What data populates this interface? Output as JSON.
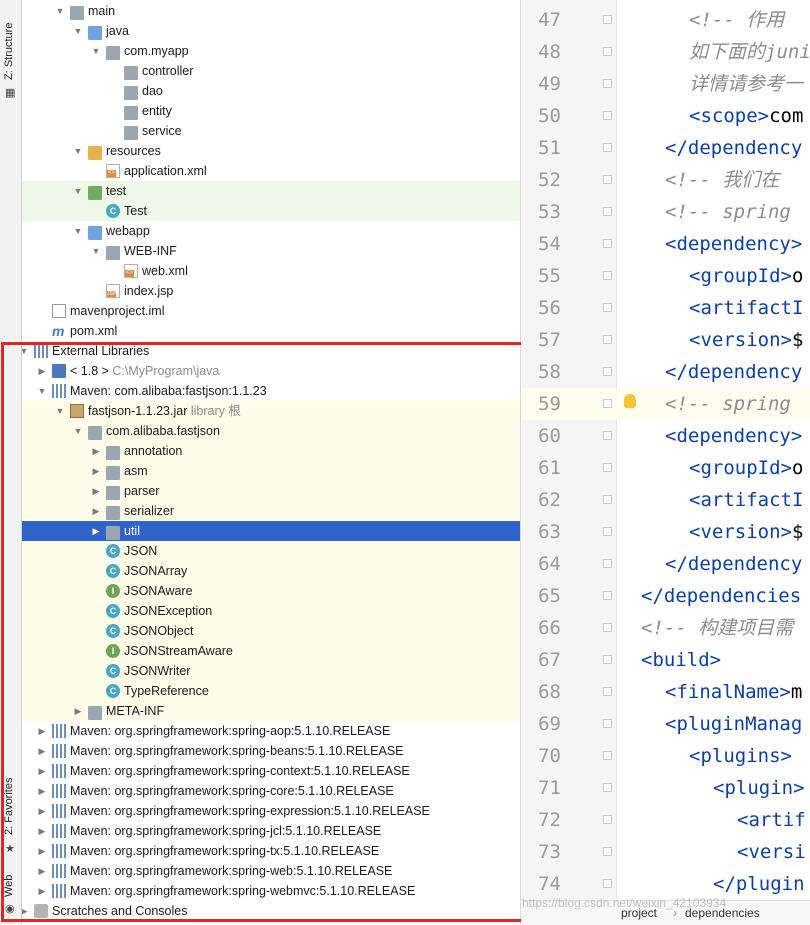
{
  "strip": {
    "structure": "Z: Structure",
    "favorites": "2: Favorites",
    "web": "Web"
  },
  "tree": [
    {
      "label": "main",
      "icon": "folder",
      "color": "gray",
      "depth": 3,
      "arrow": "down"
    },
    {
      "label": "java",
      "icon": "folder",
      "color": "blue",
      "depth": 4,
      "arrow": "down"
    },
    {
      "label": "com.myapp",
      "icon": "folder",
      "color": "gray",
      "depth": 5,
      "arrow": "down"
    },
    {
      "label": "controller",
      "icon": "folder",
      "color": "gray",
      "depth": 6,
      "arrow": ""
    },
    {
      "label": "dao",
      "icon": "folder",
      "color": "gray",
      "depth": 6,
      "arrow": ""
    },
    {
      "label": "entity",
      "icon": "folder",
      "color": "gray",
      "depth": 6,
      "arrow": ""
    },
    {
      "label": "service",
      "icon": "folder",
      "color": "gray",
      "depth": 6,
      "arrow": ""
    },
    {
      "label": "resources",
      "icon": "folder",
      "color": "yellow",
      "depth": 4,
      "arrow": "down"
    },
    {
      "label": "application.xml",
      "icon": "xml",
      "depth": 5,
      "arrow": ""
    },
    {
      "label": "test",
      "icon": "folder",
      "color": "green",
      "depth": 4,
      "arrow": "down",
      "hl": "green"
    },
    {
      "label": "Test",
      "icon": "class",
      "depth": 5,
      "arrow": "",
      "hl": "green"
    },
    {
      "label": "webapp",
      "icon": "folder",
      "color": "blue",
      "depth": 4,
      "arrow": "down"
    },
    {
      "label": "WEB-INF",
      "icon": "folder",
      "color": "gray",
      "depth": 5,
      "arrow": "down"
    },
    {
      "label": "web.xml",
      "icon": "xml",
      "depth": 6,
      "arrow": ""
    },
    {
      "label": "index.jsp",
      "icon": "jsp",
      "depth": 5,
      "arrow": ""
    },
    {
      "label": "mavenproject.iml",
      "icon": "iml",
      "depth": 2,
      "arrow": ""
    },
    {
      "label": "pom.xml",
      "icon": "mvn",
      "depth": 2,
      "arrow": ""
    },
    {
      "label": "External Libraries",
      "icon": "lib",
      "depth": 1,
      "arrow": "down"
    },
    {
      "label": "< 1.8 >",
      "extra": "C:\\MyProgram\\java",
      "icon": "sdk",
      "depth": 2,
      "arrow": "right"
    },
    {
      "label": "Maven: com.alibaba:fastjson:1.1.23",
      "icon": "lib",
      "depth": 2,
      "arrow": "down"
    },
    {
      "label": "fastjson-1.1.23.jar",
      "extra": "library 根",
      "icon": "jar",
      "depth": 3,
      "arrow": "down",
      "hl": "yellow"
    },
    {
      "label": "com.alibaba.fastjson",
      "icon": "folder",
      "color": "gray",
      "depth": 4,
      "arrow": "down",
      "hl": "yellow"
    },
    {
      "label": "annotation",
      "icon": "folder",
      "color": "gray",
      "depth": 5,
      "arrow": "right",
      "hl": "yellow"
    },
    {
      "label": "asm",
      "icon": "folder",
      "color": "gray",
      "depth": 5,
      "arrow": "right",
      "hl": "yellow"
    },
    {
      "label": "parser",
      "icon": "folder",
      "color": "gray",
      "depth": 5,
      "arrow": "right",
      "hl": "yellow"
    },
    {
      "label": "serializer",
      "icon": "folder",
      "color": "gray",
      "depth": 5,
      "arrow": "right",
      "hl": "yellow"
    },
    {
      "label": "util",
      "icon": "folder",
      "color": "gray",
      "depth": 5,
      "arrow": "right",
      "hl": "selected"
    },
    {
      "label": "JSON",
      "icon": "class",
      "depth": 5,
      "arrow": "",
      "hl": "yellow"
    },
    {
      "label": "JSONArray",
      "icon": "class",
      "depth": 5,
      "arrow": "",
      "hl": "yellow"
    },
    {
      "label": "JSONAware",
      "icon": "interface",
      "depth": 5,
      "arrow": "",
      "hl": "yellow"
    },
    {
      "label": "JSONException",
      "icon": "class",
      "depth": 5,
      "arrow": "",
      "hl": "yellow"
    },
    {
      "label": "JSONObject",
      "icon": "class",
      "depth": 5,
      "arrow": "",
      "hl": "yellow"
    },
    {
      "label": "JSONStreamAware",
      "icon": "interface",
      "depth": 5,
      "arrow": "",
      "hl": "yellow"
    },
    {
      "label": "JSONWriter",
      "icon": "class",
      "depth": 5,
      "arrow": "",
      "hl": "yellow"
    },
    {
      "label": "TypeReference",
      "icon": "class",
      "depth": 5,
      "arrow": "",
      "hl": "yellow"
    },
    {
      "label": "META-INF",
      "icon": "folder",
      "color": "gray",
      "depth": 4,
      "arrow": "right",
      "hl": "yellow"
    },
    {
      "label": "Maven: org.springframework:spring-aop:5.1.10.RELEASE",
      "icon": "lib",
      "depth": 2,
      "arrow": "right"
    },
    {
      "label": "Maven: org.springframework:spring-beans:5.1.10.RELEASE",
      "icon": "lib",
      "depth": 2,
      "arrow": "right"
    },
    {
      "label": "Maven: org.springframework:spring-context:5.1.10.RELEASE",
      "icon": "lib",
      "depth": 2,
      "arrow": "right"
    },
    {
      "label": "Maven: org.springframework:spring-core:5.1.10.RELEASE",
      "icon": "lib",
      "depth": 2,
      "arrow": "right"
    },
    {
      "label": "Maven: org.springframework:spring-expression:5.1.10.RELEASE",
      "icon": "lib",
      "depth": 2,
      "arrow": "right"
    },
    {
      "label": "Maven: org.springframework:spring-jcl:5.1.10.RELEASE",
      "icon": "lib",
      "depth": 2,
      "arrow": "right"
    },
    {
      "label": "Maven: org.springframework:spring-tx:5.1.10.RELEASE",
      "icon": "lib",
      "depth": 2,
      "arrow": "right"
    },
    {
      "label": "Maven: org.springframework:spring-web:5.1.10.RELEASE",
      "icon": "lib",
      "depth": 2,
      "arrow": "right"
    },
    {
      "label": "Maven: org.springframework:spring-webmvc:5.1.10.RELEASE",
      "icon": "lib",
      "depth": 2,
      "arrow": "right"
    },
    {
      "label": "Scratches and Consoles",
      "icon": "scratch",
      "depth": 1,
      "arrow": "right"
    }
  ],
  "editor": {
    "lines": [
      {
        "num": "47",
        "indent": 2,
        "parts": [
          {
            "t": "<!--   作用",
            "c": "cmt"
          }
        ]
      },
      {
        "num": "48",
        "indent": 2,
        "parts": [
          {
            "t": "如下面的juni",
            "c": "cmt"
          }
        ]
      },
      {
        "num": "49",
        "indent": 2,
        "parts": [
          {
            "t": "详情请参考一",
            "c": "cmt"
          }
        ]
      },
      {
        "num": "50",
        "indent": 2,
        "parts": [
          {
            "t": "<scope>",
            "c": "tag"
          },
          {
            "t": "com",
            "c": ""
          }
        ]
      },
      {
        "num": "51",
        "indent": 1,
        "parts": [
          {
            "t": "</dependency",
            "c": "tag"
          }
        ]
      },
      {
        "num": "52",
        "indent": 1,
        "parts": [
          {
            "t": "<!--  我们在",
            "c": "cmt"
          }
        ]
      },
      {
        "num": "53",
        "indent": 1,
        "parts": [
          {
            "t": "<!--  spring",
            "c": "cmt"
          }
        ]
      },
      {
        "num": "54",
        "indent": 1,
        "parts": [
          {
            "t": "<dependency>",
            "c": "tag"
          }
        ]
      },
      {
        "num": "55",
        "indent": 2,
        "parts": [
          {
            "t": "<groupId>",
            "c": "tag"
          },
          {
            "t": "o",
            "c": ""
          }
        ]
      },
      {
        "num": "56",
        "indent": 2,
        "parts": [
          {
            "t": "<artifactI",
            "c": "tag"
          }
        ]
      },
      {
        "num": "57",
        "indent": 2,
        "parts": [
          {
            "t": "<version>",
            "c": "tag"
          },
          {
            "t": "$",
            "c": ""
          }
        ]
      },
      {
        "num": "58",
        "indent": 1,
        "parts": [
          {
            "t": "</dependency",
            "c": "tag"
          }
        ]
      },
      {
        "num": "59",
        "indent": 1,
        "parts": [
          {
            "t": "<!--  spring",
            "c": "cmt"
          }
        ],
        "current": true
      },
      {
        "num": "60",
        "indent": 1,
        "parts": [
          {
            "t": "<dependency>",
            "c": "tag"
          }
        ]
      },
      {
        "num": "61",
        "indent": 2,
        "parts": [
          {
            "t": "<groupId>",
            "c": "tag"
          },
          {
            "t": "o",
            "c": ""
          }
        ]
      },
      {
        "num": "62",
        "indent": 2,
        "parts": [
          {
            "t": "<artifactI",
            "c": "tag"
          }
        ]
      },
      {
        "num": "63",
        "indent": 2,
        "parts": [
          {
            "t": "<version>",
            "c": "tag"
          },
          {
            "t": "$",
            "c": ""
          }
        ]
      },
      {
        "num": "64",
        "indent": 1,
        "parts": [
          {
            "t": "</dependency",
            "c": "tag"
          }
        ]
      },
      {
        "num": "65",
        "indent": 0,
        "parts": [
          {
            "t": "</dependencies",
            "c": "tag"
          }
        ]
      },
      {
        "num": "66",
        "indent": 0,
        "parts": [
          {
            "t": "<!-- 构建项目需",
            "c": "cmt"
          }
        ]
      },
      {
        "num": "67",
        "indent": 0,
        "parts": [
          {
            "t": "<build>",
            "c": "tag"
          }
        ]
      },
      {
        "num": "68",
        "indent": 1,
        "parts": [
          {
            "t": "<finalName>",
            "c": "tag"
          },
          {
            "t": "m",
            "c": ""
          }
        ]
      },
      {
        "num": "69",
        "indent": 1,
        "parts": [
          {
            "t": "<pluginManag",
            "c": "tag"
          }
        ]
      },
      {
        "num": "70",
        "indent": 2,
        "parts": [
          {
            "t": "<plugins>",
            "c": "tag"
          }
        ]
      },
      {
        "num": "71",
        "indent": 3,
        "parts": [
          {
            "t": "<plugin>",
            "c": "tag"
          }
        ]
      },
      {
        "num": "72",
        "indent": 4,
        "parts": [
          {
            "t": "<artif",
            "c": "tag"
          }
        ]
      },
      {
        "num": "73",
        "indent": 4,
        "parts": [
          {
            "t": "<versi",
            "c": "tag"
          }
        ]
      },
      {
        "num": "74",
        "indent": 3,
        "parts": [
          {
            "t": "</plugin",
            "c": "tag"
          }
        ]
      }
    ]
  },
  "breadcrumb": {
    "item1": "project",
    "item2": "dependencies"
  },
  "watermark": "https://blog.csdn.net/weixin_42103934"
}
